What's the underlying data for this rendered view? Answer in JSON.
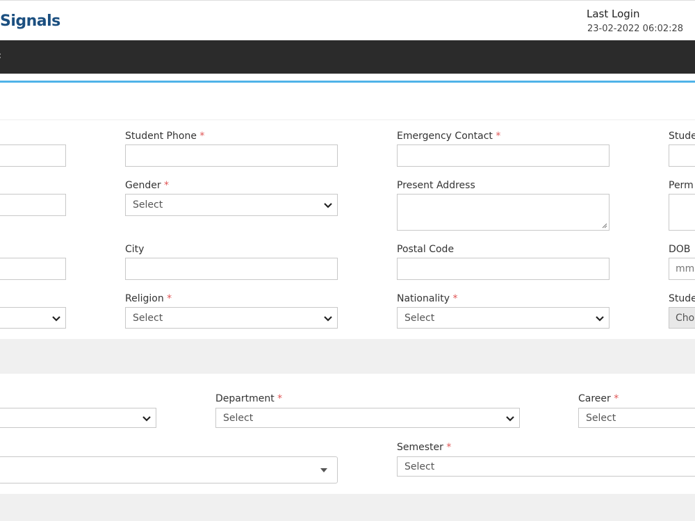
{
  "header": {
    "brand": "Signals",
    "last_login_label": "Last Login",
    "last_login_time": "23-02-2022 06:02:28"
  },
  "nav": {
    "arrow": "‹"
  },
  "form": {
    "student_phone": {
      "label": "Student Phone",
      "req": "*"
    },
    "emergency_contact": {
      "label": "Emergency Contact",
      "req": "*"
    },
    "stude_1": {
      "label": "Stude"
    },
    "gender": {
      "label": "Gender",
      "req": "*",
      "value": "Select"
    },
    "present_address": {
      "label": "Present Address"
    },
    "perm": {
      "label": "Perm"
    },
    "city": {
      "label": "City"
    },
    "postal_code": {
      "label": "Postal Code"
    },
    "dob": {
      "label": "DOB",
      "placeholder": "mm"
    },
    "religion": {
      "label": "Religion",
      "req": "*",
      "value": "Select"
    },
    "nationality": {
      "label": "Nationality",
      "req": "*",
      "value": "Select"
    },
    "stude_2": {
      "label": "Stude",
      "value": "Cho"
    }
  },
  "academic": {
    "department": {
      "label": "Department",
      "req": "*",
      "value": "Select"
    },
    "career": {
      "label": "Career",
      "req": "*",
      "value": "Select"
    },
    "semester": {
      "label": "Semester",
      "req": "*",
      "value": "Select"
    }
  }
}
